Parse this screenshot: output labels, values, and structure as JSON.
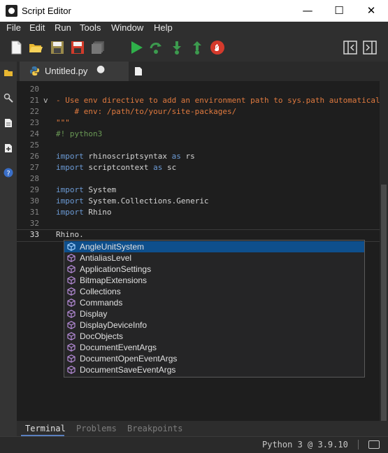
{
  "window": {
    "title": "Script Editor",
    "minimize": "—",
    "maximize": "☐",
    "close": "✕"
  },
  "menu": [
    "File",
    "Edit",
    "Run",
    "Tools",
    "Window",
    "Help"
  ],
  "toolbar": {
    "icons": [
      "new-file-icon",
      "open-folder-icon",
      "save-icon",
      "save-as-icon",
      "save-all-icon",
      "run-icon",
      "step-over-icon",
      "step-into-icon",
      "step-out-icon",
      "stop-icon",
      "collapse-left-panel-icon",
      "collapse-right-panel-icon"
    ]
  },
  "leftbar": {
    "icons": [
      "explorer-icon",
      "search-icon",
      "document-icon",
      "add-document-icon",
      "help-icon"
    ]
  },
  "tabs": {
    "active_title": "Untitled.py",
    "modified_marker": "●"
  },
  "editor": {
    "lines": [
      {
        "num": "20",
        "text": "",
        "style": "plain"
      },
      {
        "num": "21",
        "text": "- Use env directive to add an environment path to sys.path automatically",
        "style": "comment",
        "fold": "v"
      },
      {
        "num": "22",
        "text": "    # env: /path/to/your/site-packages/",
        "style": "comment"
      },
      {
        "num": "23",
        "text": "\"\"\"",
        "style": "comment"
      },
      {
        "num": "24",
        "text": "#! python3",
        "style": "green"
      },
      {
        "num": "25",
        "text": "",
        "style": "plain"
      },
      {
        "num": "26",
        "kw": "import",
        "rest": " rhinoscriptsyntax ",
        "kw2": "as",
        "rest2": " rs",
        "style": "import"
      },
      {
        "num": "27",
        "kw": "import",
        "rest": " scriptcontext ",
        "kw2": "as",
        "rest2": " sc",
        "style": "import"
      },
      {
        "num": "28",
        "text": "",
        "style": "plain"
      },
      {
        "num": "29",
        "kw": "import",
        "rest": " System",
        "kw2": "",
        "rest2": "",
        "style": "import"
      },
      {
        "num": "30",
        "kw": "import",
        "rest": " System.Collections.Generic",
        "kw2": "",
        "rest2": "",
        "style": "import"
      },
      {
        "num": "31",
        "kw": "import",
        "rest": " Rhino",
        "kw2": "",
        "rest2": "",
        "style": "import"
      },
      {
        "num": "32",
        "text": "",
        "style": "plain"
      },
      {
        "num": "33",
        "text": "Rhino.",
        "style": "plain",
        "current": true
      }
    ]
  },
  "autocomplete": {
    "items": [
      "AngleUnitSystem",
      "AntialiasLevel",
      "ApplicationSettings",
      "BitmapExtensions",
      "Collections",
      "Commands",
      "Display",
      "DisplayDeviceInfo",
      "DocObjects",
      "DocumentEventArgs",
      "DocumentOpenEventArgs",
      "DocumentSaveEventArgs"
    ],
    "selected_index": 0,
    "item_icon": "namespace-icon",
    "icon_color": "#b48ad6",
    "selected_icon_color": "#9fd0ff"
  },
  "bottom_tabs": [
    "Terminal",
    "Problems",
    "Breakpoints"
  ],
  "status": {
    "text": "Python 3 @ 3.9.10"
  },
  "colors": {
    "keyword": "#6c9bd6",
    "comment": "#e07a3f",
    "shebang": "#6a9955",
    "selection": "#0e4f8c"
  }
}
